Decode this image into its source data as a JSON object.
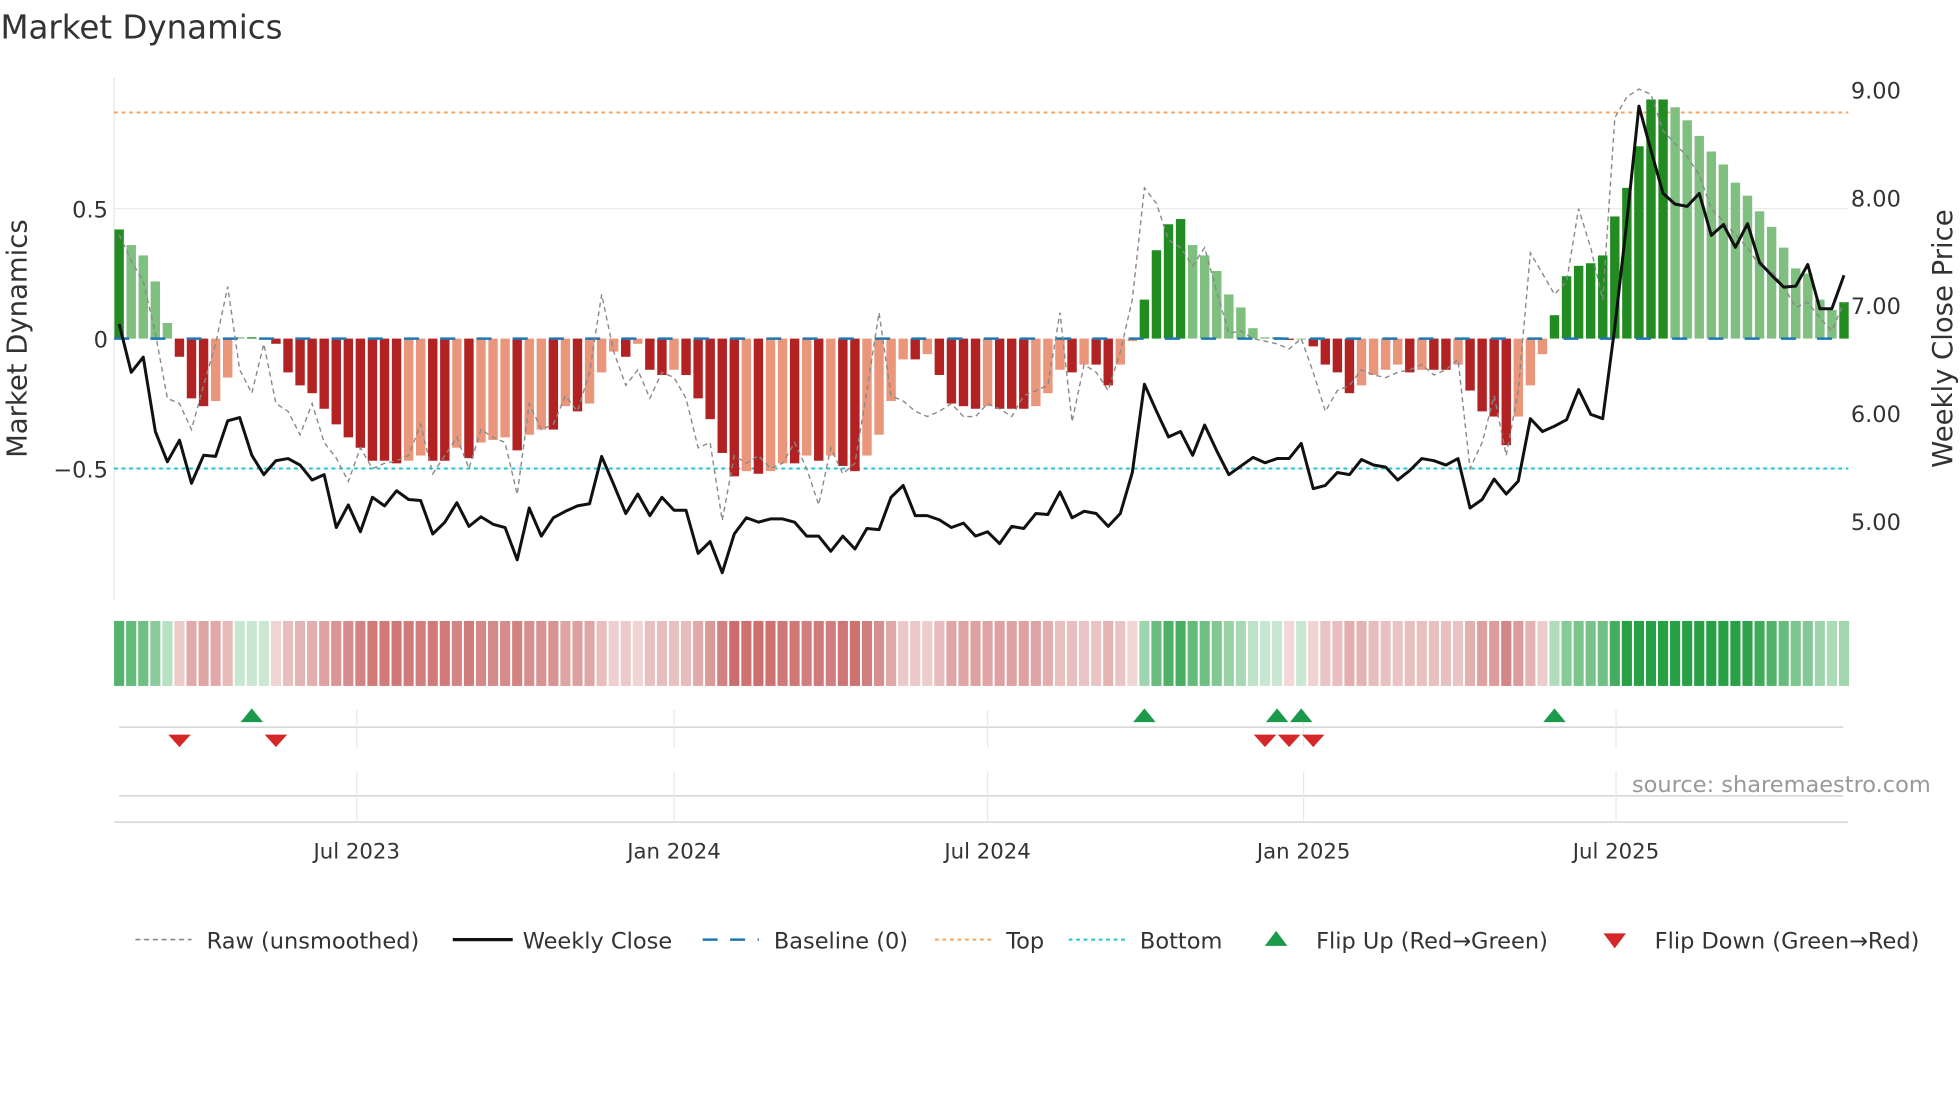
{
  "title": "Market Dynamics",
  "source": "source: sharemaestro.com",
  "colors": {
    "dark_green": "#228b22",
    "light_green": "#7fbf7f",
    "dark_red": "#b22222",
    "light_red": "#e9967a",
    "baseline": "#1f77b4",
    "top": "#f4a460",
    "bottom": "#20c5d0",
    "raw": "#888888",
    "close": "#111111",
    "flip_up": "#1a9a4a",
    "flip_down": "#d62728"
  },
  "chart_data": {
    "type": "bar",
    "title": "Market Dynamics",
    "ylabel": "Market Dynamics",
    "y2label": "Weekly Close Price",
    "ylim": [
      -1.0,
      1.0
    ],
    "y2lim": [
      4.2,
      9.2
    ],
    "yticks": [
      {
        "value": 0.5,
        "label": "0.5"
      },
      {
        "value": 0,
        "label": "0"
      },
      {
        "value": -0.5,
        "label": "−0.5"
      }
    ],
    "y2ticks": [
      {
        "value": 9,
        "label": "9.00"
      },
      {
        "value": 8,
        "label": "8.00"
      },
      {
        "value": 7,
        "label": "7.00"
      },
      {
        "value": 6,
        "label": "6.00"
      },
      {
        "value": 5,
        "label": "5.00"
      }
    ],
    "xticks": [
      {
        "week": 19.7,
        "label": "Jul 2023"
      },
      {
        "week": 46,
        "label": "Jan 2024"
      },
      {
        "week": 72,
        "label": "Jul 2024"
      },
      {
        "week": 98.2,
        "label": "Jan 2025"
      },
      {
        "week": 124.1,
        "label": "Jul 2025"
      }
    ],
    "top_level": 0.87,
    "bottom_level": -0.5,
    "baseline": 0,
    "dynamics": [
      0.42,
      0.36,
      0.32,
      0.22,
      0.06,
      -0.07,
      -0.23,
      -0.26,
      -0.24,
      -0.15,
      0.005,
      0.005,
      0,
      -0.02,
      -0.13,
      -0.18,
      -0.21,
      -0.27,
      -0.33,
      -0.38,
      -0.42,
      -0.47,
      -0.47,
      -0.48,
      -0.47,
      -0.45,
      -0.47,
      -0.47,
      -0.42,
      -0.46,
      -0.4,
      -0.39,
      -0.38,
      -0.43,
      -0.37,
      -0.35,
      -0.35,
      -0.26,
      -0.28,
      -0.25,
      -0.13,
      -0.05,
      -0.07,
      -0.02,
      -0.12,
      -0.14,
      -0.12,
      -0.14,
      -0.23,
      -0.31,
      -0.44,
      -0.53,
      -0.51,
      -0.52,
      -0.51,
      -0.48,
      -0.48,
      -0.45,
      -0.47,
      -0.45,
      -0.49,
      -0.51,
      -0.45,
      -0.37,
      -0.24,
      -0.08,
      -0.08,
      -0.06,
      -0.14,
      -0.25,
      -0.26,
      -0.27,
      -0.26,
      -0.27,
      -0.27,
      -0.27,
      -0.26,
      -0.21,
      -0.12,
      -0.13,
      -0.1,
      -0.1,
      -0.18,
      -0.1,
      -0.01,
      0.15,
      0.34,
      0.44,
      0.46,
      0.36,
      0.32,
      0.26,
      0.17,
      0.12,
      0.04,
      0.005,
      0.005,
      -0.005,
      0,
      -0.03,
      -0.1,
      -0.13,
      -0.21,
      -0.18,
      -0.14,
      -0.12,
      -0.1,
      -0.13,
      -0.12,
      -0.12,
      -0.12,
      -0.1,
      -0.2,
      -0.28,
      -0.3,
      -0.41,
      -0.3,
      -0.18,
      -0.06,
      0.09,
      0.24,
      0.28,
      0.29,
      0.32,
      0.47,
      0.58,
      0.74,
      0.92,
      0.92,
      0.89,
      0.84,
      0.78,
      0.72,
      0.67,
      0.6,
      0.55,
      0.49,
      0.43,
      0.35,
      0.27,
      0.25,
      0.15,
      0.11,
      0.14
    ],
    "raw": [
      0.4,
      0.3,
      0.22,
      0.02,
      -0.23,
      -0.25,
      -0.35,
      -0.18,
      -0.02,
      0.2,
      -0.12,
      -0.21,
      -0.02,
      -0.25,
      -0.28,
      -0.37,
      -0.25,
      -0.4,
      -0.46,
      -0.55,
      -0.42,
      -0.5,
      -0.48,
      -0.47,
      -0.45,
      -0.33,
      -0.52,
      -0.45,
      -0.38,
      -0.5,
      -0.35,
      -0.38,
      -0.4,
      -0.6,
      -0.25,
      -0.35,
      -0.33,
      -0.22,
      -0.28,
      -0.13,
      0.17,
      -0.05,
      -0.18,
      -0.12,
      -0.23,
      -0.13,
      -0.15,
      -0.23,
      -0.42,
      -0.4,
      -0.7,
      -0.45,
      -0.48,
      -0.45,
      -0.5,
      -0.48,
      -0.4,
      -0.5,
      -0.64,
      -0.42,
      -0.52,
      -0.48,
      -0.2,
      0.1,
      -0.22,
      -0.24,
      -0.28,
      -0.3,
      -0.28,
      -0.25,
      -0.3,
      -0.3,
      -0.25,
      -0.27,
      -0.3,
      -0.22,
      -0.2,
      -0.18,
      0.1,
      -0.32,
      -0.1,
      -0.13,
      -0.2,
      -0.05,
      0.15,
      0.58,
      0.52,
      0.38,
      0.35,
      0.28,
      0.35,
      0.18,
      0.02,
      0.03,
      0.0,
      -0.01,
      -0.02,
      -0.04,
      0.0,
      -0.13,
      -0.28,
      -0.2,
      -0.18,
      -0.12,
      -0.14,
      -0.15,
      -0.13,
      -0.12,
      -0.1,
      -0.14,
      -0.12,
      -0.08,
      -0.5,
      -0.4,
      -0.22,
      -0.45,
      -0.2,
      0.33,
      0.25,
      0.17,
      0.22,
      0.5,
      0.35,
      0.15,
      0.85,
      0.93,
      0.96,
      0.94,
      0.8,
      0.75,
      0.7,
      0.63,
      0.5,
      0.45,
      0.4,
      0.35,
      0.28,
      0.26,
      0.2,
      0.12,
      0.14,
      0.08,
      0.03,
      0.14
    ],
    "weekly_close": [
      6.83,
      6.38,
      6.52,
      5.83,
      5.55,
      5.75,
      5.35,
      5.61,
      5.6,
      5.93,
      5.96,
      5.61,
      5.43,
      5.56,
      5.58,
      5.52,
      5.38,
      5.43,
      4.94,
      5.15,
      4.9,
      5.22,
      5.14,
      5.28,
      5.2,
      5.19,
      4.88,
      4.99,
      5.17,
      4.95,
      5.04,
      4.97,
      4.94,
      4.64,
      5.12,
      4.86,
      5.03,
      5.09,
      5.14,
      5.16,
      5.6,
      5.34,
      5.07,
      5.25,
      5.05,
      5.22,
      5.1,
      5.1,
      4.7,
      4.81,
      4.52,
      4.88,
      5.03,
      4.99,
      5.02,
      5.02,
      4.99,
      4.86,
      4.86,
      4.72,
      4.86,
      4.74,
      4.93,
      4.92,
      5.22,
      5.33,
      5.05,
      5.05,
      5.01,
      4.94,
      4.98,
      4.86,
      4.9,
      4.79,
      4.95,
      4.93,
      5.07,
      5.06,
      5.27,
      5.03,
      5.09,
      5.07,
      4.95,
      5.07,
      5.45,
      6.27,
      6.02,
      5.78,
      5.83,
      5.61,
      5.89,
      5.65,
      5.43,
      5.51,
      5.59,
      5.54,
      5.58,
      5.58,
      5.72,
      5.3,
      5.33,
      5.45,
      5.43,
      5.57,
      5.52,
      5.5,
      5.38,
      5.47,
      5.58,
      5.56,
      5.52,
      5.58,
      5.12,
      5.2,
      5.39,
      5.25,
      5.37,
      5.95,
      5.83,
      5.88,
      5.94,
      6.22,
      5.99,
      5.95,
      6.8,
      7.78,
      8.85,
      8.44,
      8.04,
      7.94,
      7.92,
      8.04,
      7.65,
      7.75,
      7.54,
      7.76,
      7.4,
      7.28,
      7.17,
      7.18,
      7.38,
      6.97,
      6.97,
      7.28
    ],
    "flip_up_weeks": [
      11,
      85,
      96,
      98,
      119
    ],
    "flip_down_weeks": [
      5,
      13,
      95,
      97,
      99
    ],
    "legend": [
      {
        "key": "raw",
        "label": "Raw (unsmoothed)"
      },
      {
        "key": "close",
        "label": "Weekly Close"
      },
      {
        "key": "baseline",
        "label": "Baseline (0)"
      },
      {
        "key": "top",
        "label": "Top"
      },
      {
        "key": "bottom",
        "label": "Bottom"
      },
      {
        "key": "flip_up",
        "label": "Flip Up (Red→Green)"
      },
      {
        "key": "flip_down",
        "label": "Flip Down (Green→Red)"
      }
    ],
    "legend_position": "bottom"
  }
}
